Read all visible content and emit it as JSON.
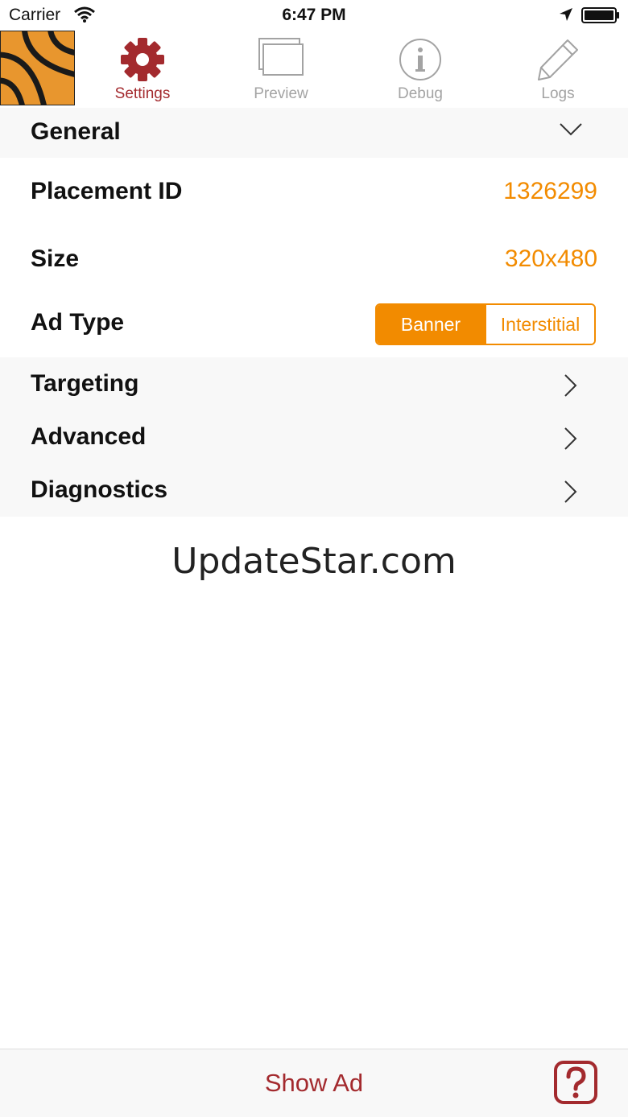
{
  "status_bar": {
    "carrier": "Carrier",
    "time": "6:47 PM"
  },
  "tabs": [
    {
      "label": "Settings",
      "icon": "gear-icon",
      "active": true
    },
    {
      "label": "Preview",
      "icon": "preview-windows-icon",
      "active": false
    },
    {
      "label": "Debug",
      "icon": "info-icon",
      "active": false
    },
    {
      "label": "Logs",
      "icon": "pencil-icon",
      "active": false
    }
  ],
  "general": {
    "header": "General",
    "placement_id": {
      "label": "Placement ID",
      "value": "1326299"
    },
    "size": {
      "label": "Size",
      "value": "320x480"
    },
    "ad_type": {
      "label": "Ad Type",
      "options": [
        "Banner",
        "Interstitial"
      ],
      "selected": "Banner"
    }
  },
  "nav_items": [
    {
      "label": "Targeting"
    },
    {
      "label": "Advanced"
    },
    {
      "label": "Diagnostics"
    }
  ],
  "watermark": "UpdateStar.com",
  "bottom": {
    "show_ad_label": "Show Ad"
  },
  "colors": {
    "accent": "#f28b00",
    "brand_red": "#a32a2e",
    "logo_orange": "#e8962e"
  }
}
